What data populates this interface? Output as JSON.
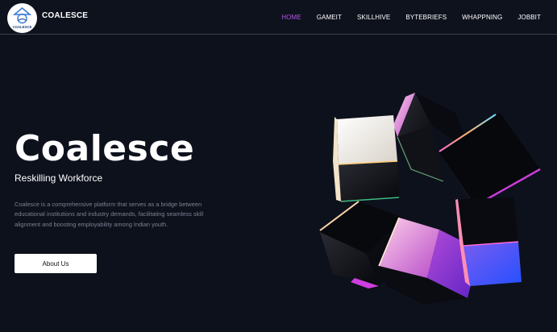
{
  "header": {
    "brand": "COALESCE",
    "logo_text": "COALESCE",
    "nav": [
      {
        "label": "HOME",
        "active": true
      },
      {
        "label": "GAMEIT",
        "active": false
      },
      {
        "label": "SKILLHIVE",
        "active": false
      },
      {
        "label": "BYTEBRIEFS",
        "active": false
      },
      {
        "label": "WHAPPNING",
        "active": false
      },
      {
        "label": "JOBBIT",
        "active": false
      }
    ]
  },
  "hero": {
    "title": "Coalesce",
    "subtitle": "Reskilling Workforce",
    "description": "Coalesce is a comprehensive platform that serves as a bridge between educational institutions and industry demands, facilitating seamless skill alignment and boosting employability among Indian youth.",
    "button_label": "About Us"
  },
  "colors": {
    "background": "#0d111c",
    "nav_active": "#b558e8",
    "nav_text": "#ffffff",
    "description_text": "#7b8190",
    "button_bg": "#ffffff"
  },
  "icons": [
    "coalesce-logo-icon",
    "cubes-illustration"
  ]
}
